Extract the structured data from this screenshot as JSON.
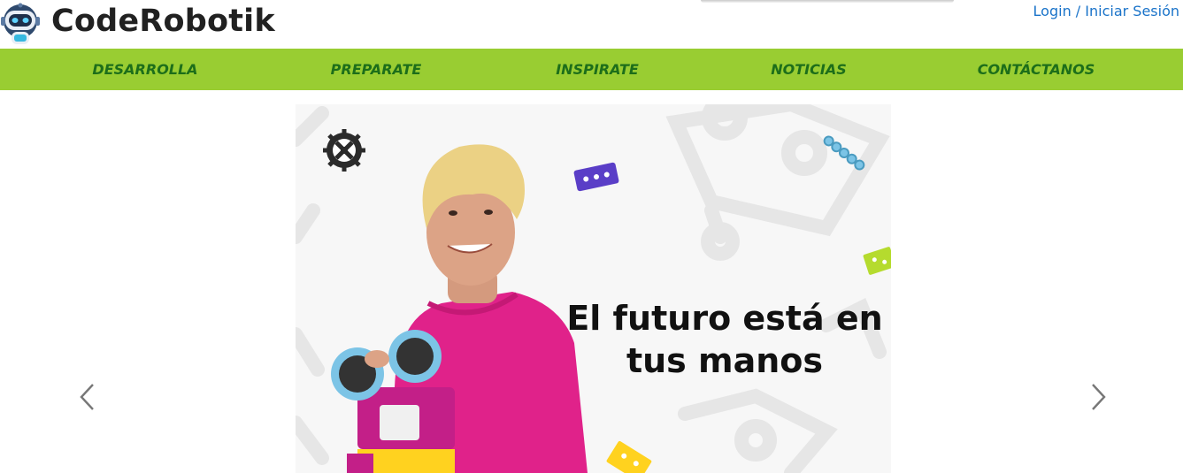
{
  "header": {
    "brand": "CodeRobotik",
    "login_label": "Login / Iniciar Sesión",
    "logo_icon": "robot-logo-icon"
  },
  "nav": {
    "items": [
      {
        "label": "DESARROLLA"
      },
      {
        "label": "PREPARATE"
      },
      {
        "label": "INSPIRATE"
      },
      {
        "label": "NOTICIAS"
      },
      {
        "label": "CONTÁCTANOS"
      }
    ]
  },
  "carousel": {
    "headline_line1": "El futuro está en",
    "headline_line2": "tus manos",
    "prev_icon": "chevron-left-icon",
    "next_icon": "chevron-right-icon"
  },
  "colors": {
    "nav_bg": "#99cd32",
    "nav_text": "#1d6e1a",
    "link": "#1a73c9",
    "brand_text": "#212121"
  }
}
